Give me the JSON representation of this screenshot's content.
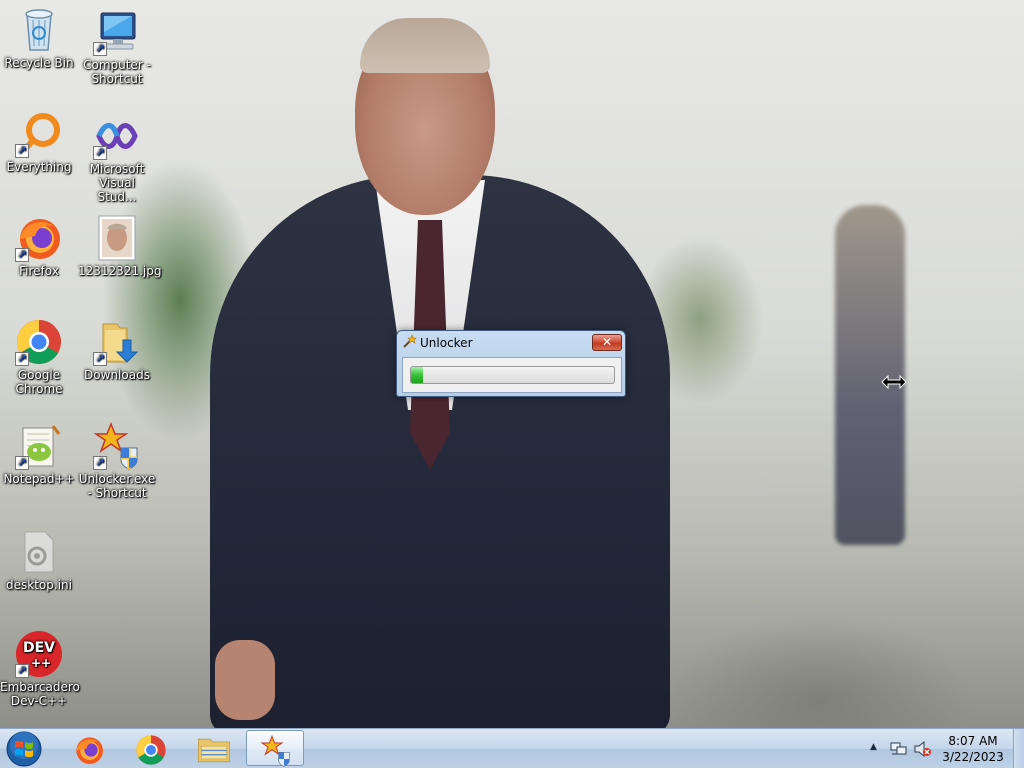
{
  "desktop": {
    "icons": [
      {
        "label": "Recycle Bin",
        "icon": "recycle-bin-icon",
        "shortcut": false
      },
      {
        "label": "Computer - Shortcut",
        "icon": "computer-icon",
        "shortcut": true
      },
      {
        "label": "Everything",
        "icon": "everything-icon",
        "shortcut": true
      },
      {
        "label": "Microsoft Visual Stud...",
        "icon": "visual-studio-icon",
        "shortcut": true
      },
      {
        "label": "Firefox",
        "icon": "firefox-icon",
        "shortcut": true
      },
      {
        "label": "12312321.jpg",
        "icon": "image-file-icon",
        "shortcut": false
      },
      {
        "label": "Google Chrome",
        "icon": "chrome-icon",
        "shortcut": true
      },
      {
        "label": "Downloads",
        "icon": "downloads-folder-icon",
        "shortcut": true
      },
      {
        "label": "Notepad++",
        "icon": "notepadpp-icon",
        "shortcut": true
      },
      {
        "label": "Unlocker.exe - Shortcut",
        "icon": "unlocker-icon",
        "shortcut": true
      },
      {
        "label": "desktop.ini",
        "icon": "settings-file-icon",
        "shortcut": false
      },
      {
        "label": "Embarcadero Dev-C++",
        "icon": "devcpp-icon",
        "shortcut": true
      }
    ]
  },
  "dialog": {
    "title": "Unlocker",
    "close_label": "✕",
    "progress": 0.06
  },
  "taskbar": {
    "start_icon": "windows-start-icon",
    "pinned": [
      {
        "name": "firefox",
        "icon": "firefox-icon"
      },
      {
        "name": "chrome",
        "icon": "chrome-icon"
      },
      {
        "name": "explorer",
        "icon": "folder-icon"
      },
      {
        "name": "unlocker",
        "icon": "unlocker-icon",
        "active": true
      }
    ],
    "tray": {
      "chevron": "▲",
      "time": "8:07 AM",
      "date": "3/22/2023"
    }
  },
  "colors": {
    "taskbar": "#c5d6ea",
    "progress_fill": "#37c437",
    "close_button": "#c23a24"
  }
}
